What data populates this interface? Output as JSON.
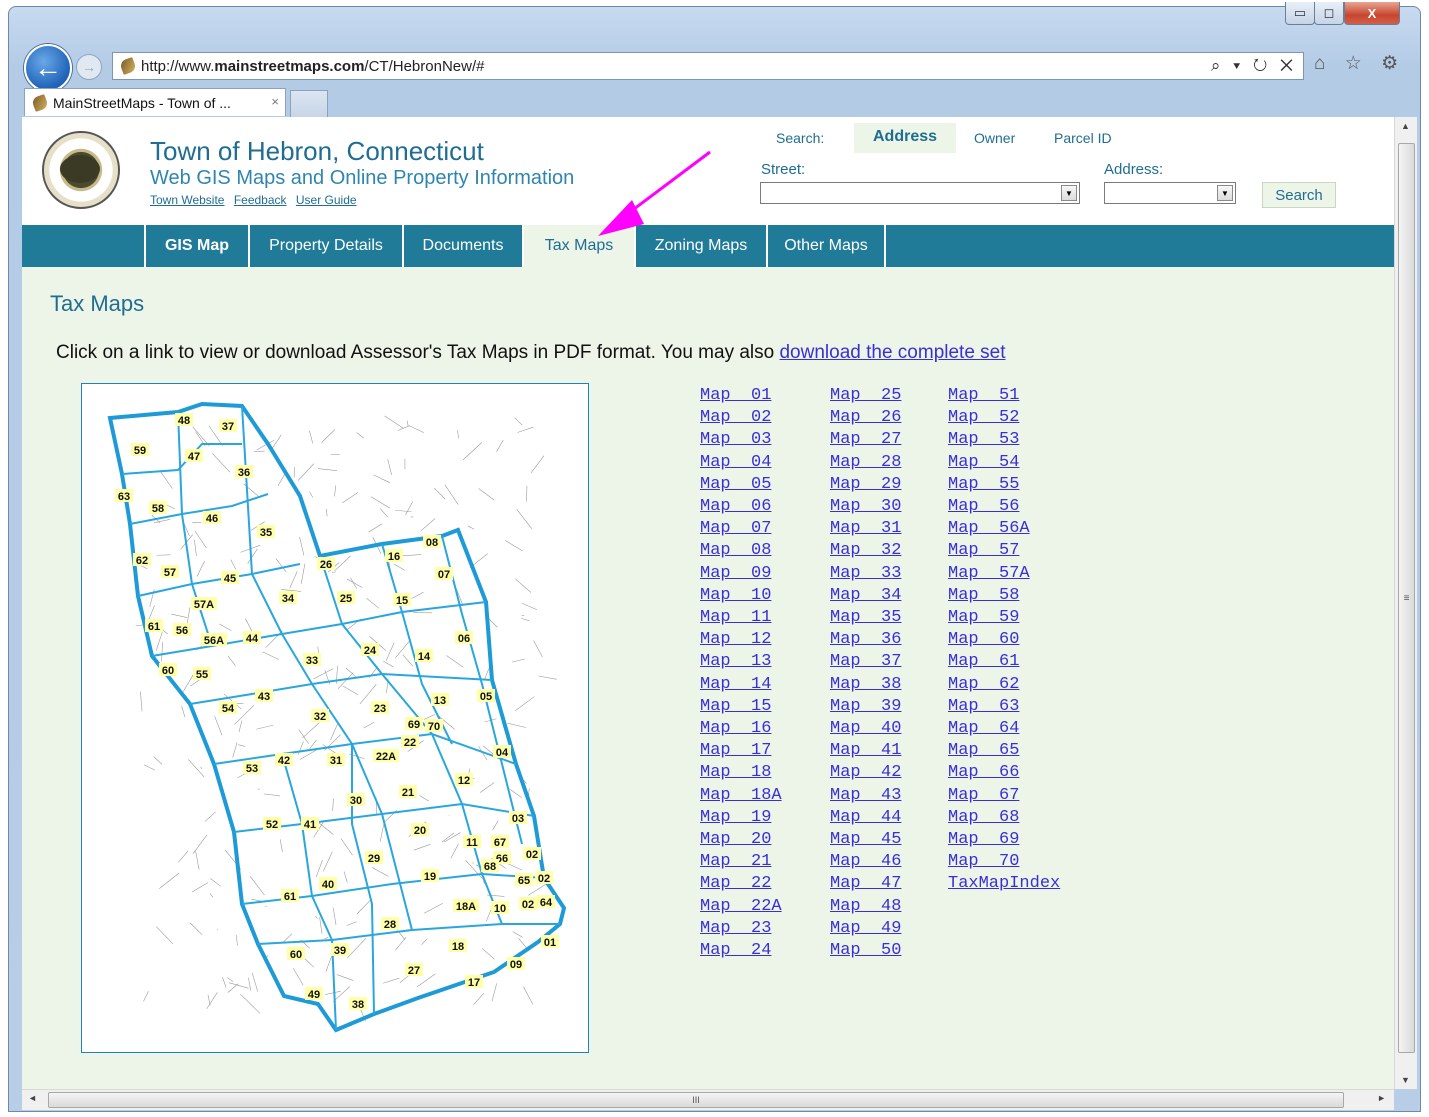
{
  "browser": {
    "url_prefix": "http://www.",
    "url_domain": "mainstreetmaps.com",
    "url_path": "/CT/HebronNew/#",
    "tab_title": "MainStreetMaps - Town of ...",
    "tab_close": "×",
    "addr_tools": "⌕ ▾ ↻ ✕",
    "right_icons": "⌂ ☆ ⚙",
    "caption": {
      "minimize": "▭",
      "maximize": "◻",
      "close": "X"
    },
    "back": "←",
    "forward": "→"
  },
  "header": {
    "title": "Town of Hebron, Connecticut",
    "subtitle": "Web GIS Maps and Online Property Information",
    "links": [
      "Town Website",
      "Feedback",
      "User Guide"
    ]
  },
  "search": {
    "label": "Search:",
    "tabs": [
      "Address",
      "Owner",
      "Parcel ID"
    ],
    "street_label": "Street:",
    "address_label": "Address:",
    "button": "Search"
  },
  "nav": {
    "tabs": [
      "GIS Map",
      "Property Details",
      "Documents",
      "Tax Maps",
      "Zoning Maps",
      "Other Maps"
    ],
    "active": "Tax Maps"
  },
  "content": {
    "title": "Tax Maps",
    "intro_text": "Click on a link to view or download Assessor's Tax Maps in PDF format.  You may also ",
    "intro_link": "download the complete set"
  },
  "map_labels": [
    "48",
    "37",
    "59",
    "47",
    "36",
    "63",
    "58",
    "46",
    "35",
    "08",
    "16",
    "62",
    "26",
    "57",
    "45",
    "07",
    "57A",
    "34",
    "25",
    "15",
    "61",
    "56",
    "56A",
    "44",
    "06",
    "24",
    "60",
    "33",
    "14",
    "55",
    "13",
    "05",
    "54",
    "43",
    "23",
    "69",
    "70",
    "32",
    "22",
    "04",
    "22A",
    "53",
    "42",
    "31",
    "12",
    "21",
    "30",
    "52",
    "41",
    "03",
    "20",
    "11",
    "67",
    "02",
    "66",
    "68",
    "29",
    "65",
    "02",
    "19",
    "61",
    "40",
    "64",
    "18A",
    "10",
    "02",
    "28",
    "01",
    "39",
    "60",
    "18",
    "27",
    "09",
    "49",
    "17",
    "38"
  ],
  "map_columns": [
    [
      "Map 01",
      "Map 02",
      "Map 03",
      "Map 04",
      "Map 05",
      "Map 06",
      "Map 07",
      "Map 08",
      "Map 09",
      "Map 10",
      "Map 11",
      "Map 12",
      "Map 13",
      "Map 14",
      "Map 15",
      "Map 16",
      "Map 17",
      "Map 18",
      "Map 18A",
      "Map 19",
      "Map 20",
      "Map 21",
      "Map 22",
      "Map 22A",
      "Map 23",
      "Map 24"
    ],
    [
      "Map 25",
      "Map 26",
      "Map 27",
      "Map 28",
      "Map 29",
      "Map 30",
      "Map 31",
      "Map 32",
      "Map 33",
      "Map 34",
      "Map 35",
      "Map 36",
      "Map 37",
      "Map 38",
      "Map 39",
      "Map 40",
      "Map 41",
      "Map 42",
      "Map 43",
      "Map 44",
      "Map 45",
      "Map 46",
      "Map 47",
      "Map 48",
      "Map 49",
      "Map 50"
    ],
    [
      "Map 51",
      "Map 52",
      "Map 53",
      "Map 54",
      "Map 55",
      "Map 56",
      "Map 56A",
      "Map 57",
      "Map 57A",
      "Map 58",
      "Map 59",
      "Map 60",
      "Map 61",
      "Map 62",
      "Map 63",
      "Map 64",
      "Map 65",
      "Map 66",
      "Map 67",
      "Map 68",
      "Map 69",
      "Map 70",
      "TaxMapIndex"
    ]
  ],
  "scroll": {
    "grip_v": "≡",
    "grip_h": "III",
    "up": "▲",
    "down": "▼",
    "left": "◄",
    "right": "►"
  },
  "colors": {
    "accent": "#1f7b98",
    "title": "#1f6d92",
    "link": "#3a2fd6",
    "content_bg": "#edf5e8",
    "annotation_arrow": "#ff00ff",
    "map_border": "#1e9ad6"
  }
}
